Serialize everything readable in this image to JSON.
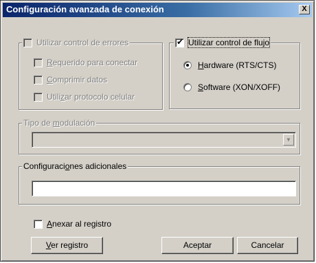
{
  "window": {
    "title": "Configuración avanzada de conexión",
    "close_label": "X"
  },
  "error_control": {
    "legend": "Utilizar control de errores",
    "options": [
      {
        "pre": "",
        "key": "R",
        "post": "equerido para conectar"
      },
      {
        "pre": "",
        "key": "C",
        "post": "omprimir datos"
      },
      {
        "pre": "Utili",
        "key": "z",
        "post": "ar protocolo celular"
      }
    ]
  },
  "flow_control": {
    "legend_pre": "Utilizar control de flu",
    "legend_key": "j",
    "legend_post": "o",
    "hardware": {
      "key": "H",
      "post": "ardware (RTS/CTS)"
    },
    "software": {
      "key": "S",
      "post": "oftware (XON/XOFF)"
    }
  },
  "modulation": {
    "legend_pre": "Tipo de ",
    "legend_key": "m",
    "legend_post": "odulación",
    "value": ""
  },
  "extra": {
    "legend_pre": "Configuraci",
    "legend_key": "o",
    "legend_post": "nes adicionales",
    "value": ""
  },
  "append_log": {
    "key": "A",
    "post": "nexar al registro"
  },
  "buttons": {
    "view_log_key": "V",
    "view_log_post": "er registro",
    "accept": "Aceptar",
    "cancel": "Cancelar"
  }
}
